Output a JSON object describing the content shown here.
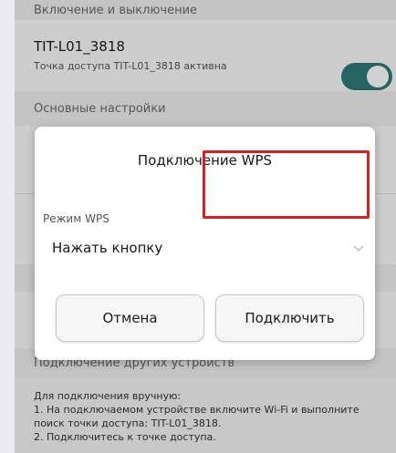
{
  "settings": {
    "section_onoff": "Включение и выключение",
    "hotspot_name": "TIT-L01_3818",
    "hotspot_status": "Точка доступа TIT-L01_3818 активна",
    "section_basic": "Основные настройки",
    "section_connect": "Подключение других устройств",
    "info_lines": [
      "Для подключения вручную:",
      "1. На подключаемом устройстве включите Wi-Fi и выполните поиск точки доступа: TIT-L01_3818.",
      "2. Подключитесь к точке доступа."
    ]
  },
  "dialog": {
    "title": "Подключение WPS",
    "field_label": "Режим WPS",
    "selected_value": "Нажать кнопку",
    "cancel_label": "Отмена",
    "connect_label": "Подключить"
  },
  "colors": {
    "toggle_on": "#2f7a78",
    "highlight": "#d91f1f"
  },
  "icons": {
    "select_chevron": "chevron-down-icon"
  }
}
